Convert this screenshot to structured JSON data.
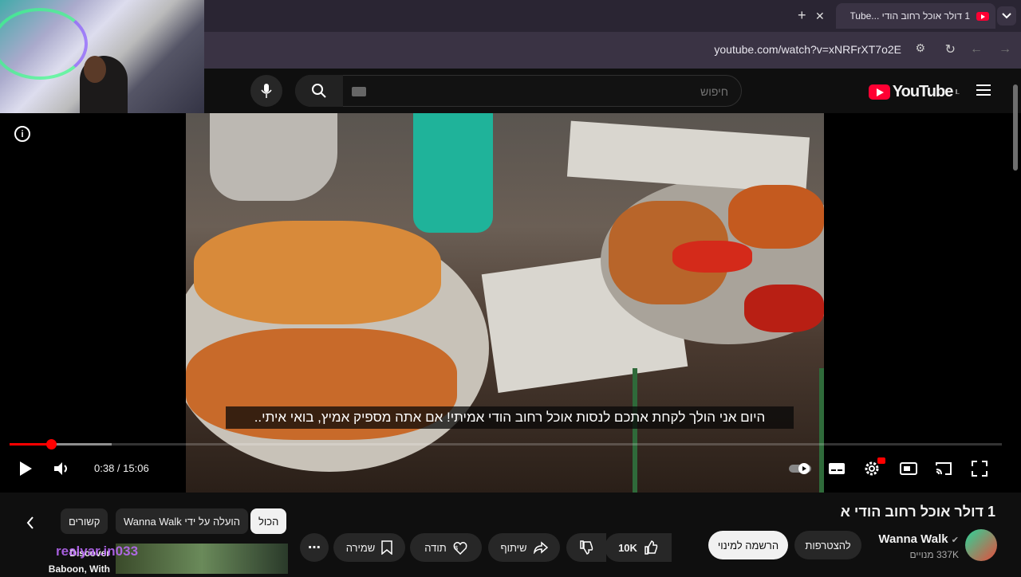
{
  "browser": {
    "tab_title": "1 דולר אוכל רחוב הודי ...YouTube",
    "url": "youtube.com/watch?v=xNRFrXT7o2E"
  },
  "header": {
    "logo_text": "YouTube",
    "region": "IL",
    "search_placeholder": "חיפוש"
  },
  "player": {
    "subtitle": "היום אני הולך לקחת אתכם לנסות אוכל רחוב הודי אמיתי! אם אתה מספיק אמיץ, בואי איתי..",
    "current_time": "0:38",
    "duration": "15:06",
    "time_display": "0:38 / 15:06",
    "progress_fraction": 0.042,
    "buffered_fraction": 0.103
  },
  "video": {
    "title": "1 דולר אוכל רחוב הודי א",
    "channel": "Wanna Walk",
    "subscribers": "337K מנויים",
    "join_label": "להצטרפות",
    "subscribe_label": "הרשמה למינוי",
    "likes": "10K",
    "share_label": "שיתוף",
    "thanks_label": "תודה",
    "save_label": "שמירה"
  },
  "chips": {
    "all": "הכול",
    "uploaded_by": "הועלה על ידי Wanna Walk",
    "related": "קשורים"
  },
  "suggested": {
    "title_line1": "Discover",
    "title_line2": "Baboon, With",
    "overlay_text": "realyar.in033"
  },
  "colors": {
    "accent": "#ff0000",
    "brand": "#ff0033",
    "bg": "#0f0f0f"
  }
}
